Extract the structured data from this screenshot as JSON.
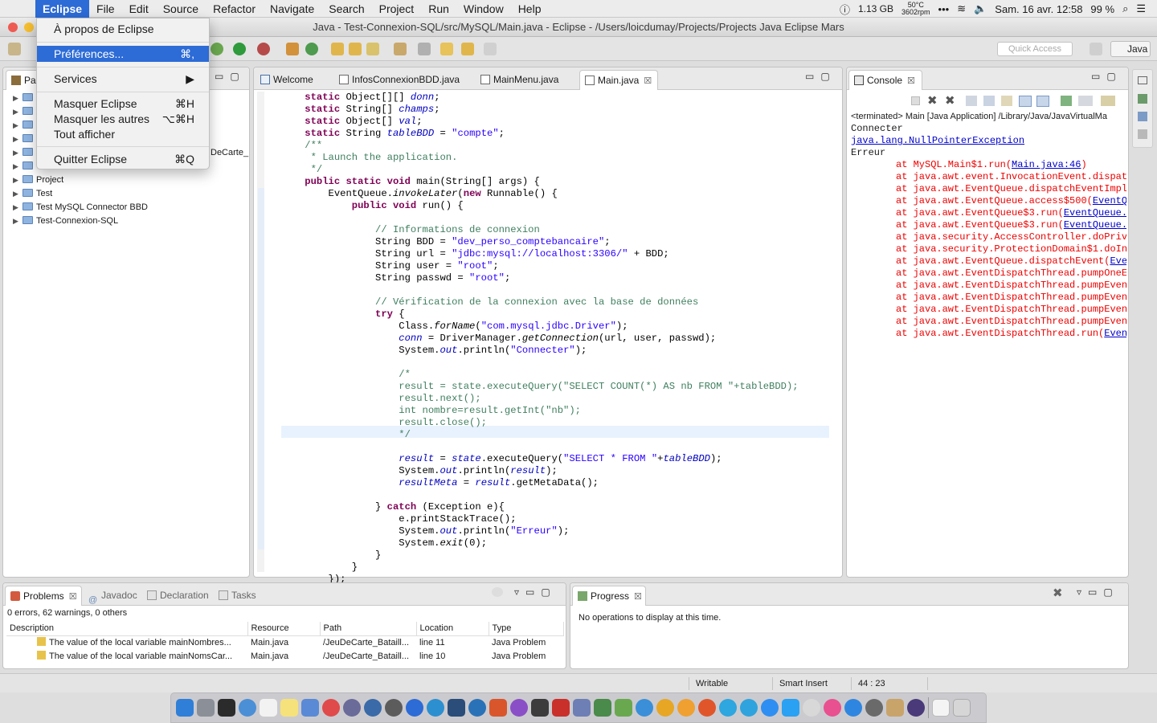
{
  "menubar": {
    "apple": "",
    "items": [
      "Eclipse",
      "File",
      "Edit",
      "Source",
      "Refactor",
      "Navigate",
      "Search",
      "Project",
      "Run",
      "Window",
      "Help"
    ],
    "status": {
      "memory": "1.13 GB",
      "temp": "50°C",
      "rpm": "3602rpm",
      "battery": "99 %",
      "datetime": "Sam. 16 avr.  12:58"
    }
  },
  "window": {
    "title": "Java - Test-Connexion-SQL/src/MySQL/Main.java - Eclipse - /Users/loicdumay/Projects/Projects Java Eclipse Mars"
  },
  "toolbar": {
    "quick_access": "Quick Access",
    "perspective": "Java"
  },
  "app_menu": {
    "about": "À propos de Eclipse",
    "prefs": "Préférences...",
    "prefs_sc": "⌘,",
    "services": "Services",
    "services_sc": "▶",
    "hide": "Masquer Eclipse",
    "hide_sc": "⌘H",
    "hide_others": "Masquer les autres",
    "hide_others_sc": "⌥⌘H",
    "show_all": "Tout afficher",
    "quit": "Quitter Eclipse",
    "quit_sc": "⌘Q"
  },
  "package_explorer": {
    "tab": "Pac",
    "hidden_row": "DeCarte_",
    "items": [
      "Project",
      "Test",
      "Test MySQL Connector BBD",
      "Test-Connexion-SQL"
    ]
  },
  "editor": {
    "tabs": [
      "Welcome",
      "InfosConnexionBDD.java",
      "MainMenu.java",
      "Main.java"
    ],
    "close": "☒"
  },
  "console": {
    "tab": "Console",
    "header": "<terminated> Main [Java Application] /Library/Java/JavaVirtualMa",
    "line1": "Connecter",
    "exception": "java.lang.NullPointerException",
    "line3": "Erreur",
    "trace": [
      {
        "text": "at MySQL.Main$1.run(",
        "link": "Main.java:46",
        "end": ")"
      },
      {
        "text": "at java.awt.event.InvocationEvent.dispatc",
        "link": "",
        "end": ""
      },
      {
        "text": "at java.awt.EventQueue.dispatchEventImpl(",
        "link": "",
        "end": ""
      },
      {
        "text": "at java.awt.EventQueue.access$500(",
        "link": "EventQu",
        "end": ""
      },
      {
        "text": "at java.awt.EventQueue$3.run(",
        "link": "EventQueue.j",
        "end": ""
      },
      {
        "text": "at java.awt.EventQueue$3.run(",
        "link": "EventQueue.j",
        "end": ""
      },
      {
        "text": "at java.security.AccessController.doPrivi",
        "link": "",
        "end": ""
      },
      {
        "text": "at java.security.ProtectionDomain$1.doInt",
        "link": "",
        "end": ""
      },
      {
        "text": "at java.awt.EventQueue.dispatchEvent(",
        "link": "Even",
        "end": ""
      },
      {
        "text": "at java.awt.EventDispatchThread.pumpOneEv",
        "link": "",
        "end": ""
      },
      {
        "text": "at java.awt.EventDispatchThread.pumpEvent",
        "link": "",
        "end": ""
      },
      {
        "text": "at java.awt.EventDispatchThread.pumpEvent",
        "link": "",
        "end": ""
      },
      {
        "text": "at java.awt.EventDispatchThread.pumpEvent",
        "link": "",
        "end": ""
      },
      {
        "text": "at java.awt.EventDispatchThread.pumpEvent",
        "link": "",
        "end": ""
      },
      {
        "text": "at java.awt.EventDispatchThread.run(",
        "link": "Event",
        "end": ""
      }
    ]
  },
  "problems": {
    "tabs": [
      "Problems",
      "Javadoc",
      "Declaration",
      "Tasks"
    ],
    "summary": "0 errors, 62 warnings, 0 others",
    "columns": [
      "Description",
      "Resource",
      "Path",
      "Location",
      "Type"
    ],
    "rows": [
      [
        "The value of the local variable mainNombres...",
        "Main.java",
        "/JeuDeCarte_Bataill...",
        "line 11",
        "Java Problem"
      ],
      [
        "The value of the local variable mainNomsCar...",
        "Main.java",
        "/JeuDeCarte_Bataill...",
        "line 10",
        "Java Problem"
      ]
    ]
  },
  "progress": {
    "tab": "Progress",
    "message": "No operations to display at this time."
  },
  "statusbar": {
    "writable": "Writable",
    "insert": "Smart Insert",
    "position": "44 : 23"
  }
}
